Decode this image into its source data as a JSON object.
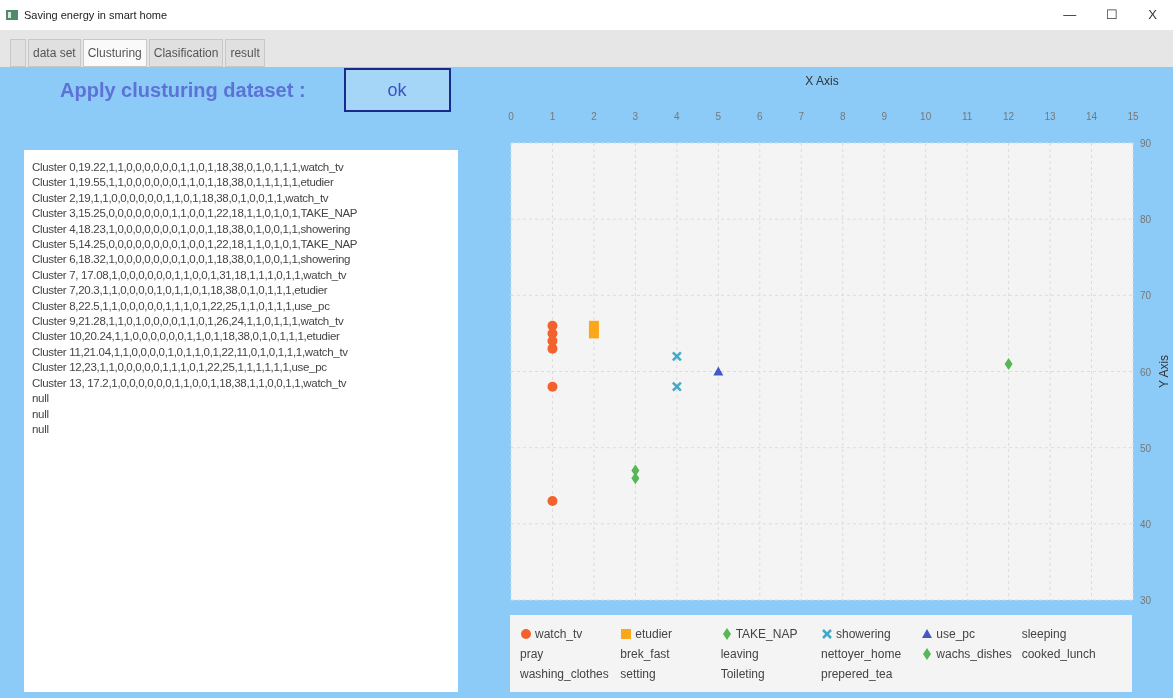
{
  "window": {
    "title": "Saving energy in smart home",
    "controls": [
      "—",
      "☐",
      "X"
    ]
  },
  "tabs": [
    {
      "label": "data set",
      "selected": false
    },
    {
      "label": "Clusturing",
      "selected": true
    },
    {
      "label": "Clasification",
      "selected": false
    },
    {
      "label": "result",
      "selected": false
    }
  ],
  "heading": "Apply clusturing dataset :",
  "ok_button": "ok",
  "output_lines": [
    "Cluster 0,19.22,1,1,0,0,0,0,0,0,1,1,0,1,18,38,0,1,0,1,1,1,watch_tv",
    "Cluster 1,19.55,1,1,0,0,0,0,0,0,1,1,0,1,18,38,0,1,1,1,1,1,etudier",
    "Cluster 2,19,1,1,0,0,0,0,0,0,1,1,0,1,18,38,0,1,0,0,1,1,watch_tv",
    "Cluster 3,15.25,0,0,0,0,0,0,0,1,1,0,0,1,22,18,1,1,0,1,0,1,TAKE_NAP",
    "Cluster 4,18.23,1,0,0,0,0,0,0,0,1,0,0,1,18,38,0,1,0,0,1,1,showering",
    "Cluster 5,14.25,0,0,0,0,0,0,0,0,1,0,0,1,22,18,1,1,0,1,0,1,TAKE_NAP",
    "Cluster 6,18.32,1,0,0,0,0,0,0,0,1,0,0,1,18,38,0,1,0,0,1,1,showering",
    "Cluster 7, 17.08,1,0,0,0,0,0,0,1,1,0,0,1,31,18,1,1,1,0,1,1,watch_tv",
    "Cluster 7,20.3,1,1,0,0,0,0,1,0,1,1,0,1,18,38,0,1,0,1,1,1,etudier",
    "Cluster 8,22.5,1,1,0,0,0,0,0,1,1,1,0,1,22,25,1,1,0,1,1,1,use_pc",
    "Cluster 9,21.28,1,1,0,1,0,0,0,0,1,1,0,1,26,24,1,1,0,1,1,1,watch_tv",
    "Cluster 10,20.24,1,1,0,0,0,0,0,0,1,1,0,1,18,38,0,1,0,1,1,1,etudier",
    "Cluster 11,21.04,1,1,0,0,0,0,1,0,1,1,0,1,22,11,0,1,0,1,1,1,watch_tv",
    "Cluster 12,23,1,1,0,0,0,0,0,1,1,1,0,1,22,25,1,1,1,1,1,1,use_pc",
    "Cluster 13, 17.2,1,0,0,0,0,0,0,1,1,0,0,1,18,38,1,1,0,0,1,1,watch_tv",
    "null",
    "null",
    "null"
  ],
  "chart_data": {
    "type": "scatter",
    "grid": true,
    "xlabel": "X Axis",
    "ylabel": "Y Axis",
    "xlim": [
      0,
      15
    ],
    "ylim": [
      30,
      90
    ],
    "xticks": [
      0,
      1,
      2,
      3,
      4,
      5,
      6,
      7,
      8,
      9,
      10,
      11,
      12,
      13,
      14,
      15
    ],
    "yticks": [
      30,
      40,
      50,
      60,
      70,
      80,
      90
    ],
    "series": [
      {
        "name": "watch_tv",
        "color": "#f3622d",
        "marker": "circle",
        "x": [
          1,
          1,
          1,
          1,
          1,
          1
        ],
        "values": [
          66,
          65,
          64,
          63,
          58,
          43
        ]
      },
      {
        "name": "etudier",
        "color": "#fba71b",
        "marker": "square",
        "x": [
          2,
          2
        ],
        "values": [
          66,
          65
        ]
      },
      {
        "name": "TAKE_NAP",
        "color": "#57b757",
        "marker": "diamond",
        "x": [
          3,
          3
        ],
        "values": [
          47,
          46
        ]
      },
      {
        "name": "showering",
        "color": "#41a9c9",
        "marker": "cross",
        "x": [
          4,
          4
        ],
        "values": [
          62,
          58
        ]
      },
      {
        "name": "use_pc",
        "color": "#4258c9",
        "marker": "triangle",
        "x": [
          5
        ],
        "values": [
          60
        ]
      },
      {
        "name": "sleeping"
      },
      {
        "name": "pray"
      },
      {
        "name": "brek_fast"
      },
      {
        "name": "leaving"
      },
      {
        "name": "nettoyer_home"
      },
      {
        "name": "wachs_dishes",
        "color": "#57b757",
        "marker": "diamond",
        "x": [
          12
        ],
        "values": [
          61
        ]
      },
      {
        "name": "cooked_lunch"
      },
      {
        "name": "washing_clothes"
      },
      {
        "name": "setting"
      },
      {
        "name": "Toileting"
      },
      {
        "name": "prepered_tea"
      }
    ]
  }
}
